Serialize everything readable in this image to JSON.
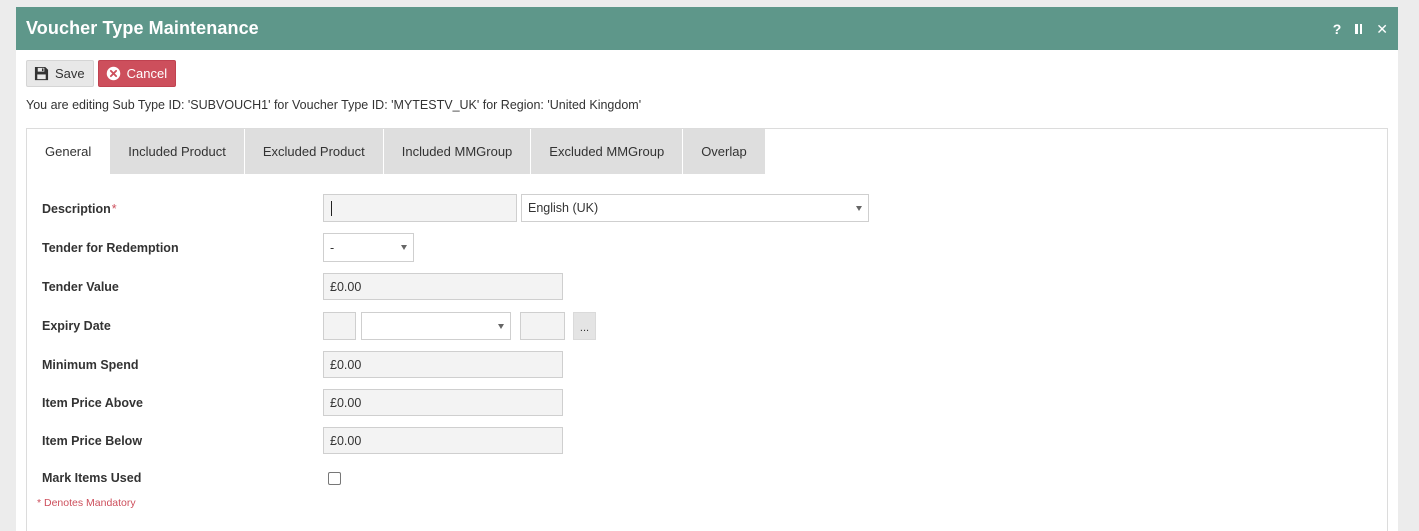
{
  "window": {
    "title": "Voucher Type Maintenance",
    "controls": {
      "help": "?",
      "pause": "II",
      "close": "✕"
    }
  },
  "toolbar": {
    "save_label": "Save",
    "cancel_label": "Cancel"
  },
  "edit_info": "You are editing Sub Type ID: 'SUBVOUCH1' for Voucher Type ID: 'MYTESTV_UK' for Region: 'United Kingdom'",
  "tabs": [
    {
      "label": "General",
      "active": true
    },
    {
      "label": "Included Product",
      "active": false
    },
    {
      "label": "Excluded Product",
      "active": false
    },
    {
      "label": "Included MMGroup",
      "active": false
    },
    {
      "label": "Excluded MMGroup",
      "active": false
    },
    {
      "label": "Overlap",
      "active": false
    }
  ],
  "form": {
    "description": {
      "label": "Description",
      "required_mark": "*",
      "value": "",
      "language": "English (UK)"
    },
    "tender_for_redemption": {
      "label": "Tender for Redemption",
      "value": "-"
    },
    "tender_value": {
      "label": "Tender Value",
      "value": "£0.00"
    },
    "expiry_date": {
      "label": "Expiry Date",
      "day": "",
      "month": "",
      "year": "",
      "picker_label": "..."
    },
    "minimum_spend": {
      "label": "Minimum Spend",
      "value": "£0.00"
    },
    "item_price_above": {
      "label": "Item Price Above",
      "value": "£0.00"
    },
    "item_price_below": {
      "label": "Item Price Below",
      "value": "£0.00"
    },
    "mark_items_used": {
      "label": "Mark Items Used",
      "checked": false
    }
  },
  "mandatory_note": "* Denotes Mandatory",
  "colors": {
    "titlebar": "#5e978a",
    "cancel": "#cd4f5c",
    "required": "#cd4f5c"
  }
}
